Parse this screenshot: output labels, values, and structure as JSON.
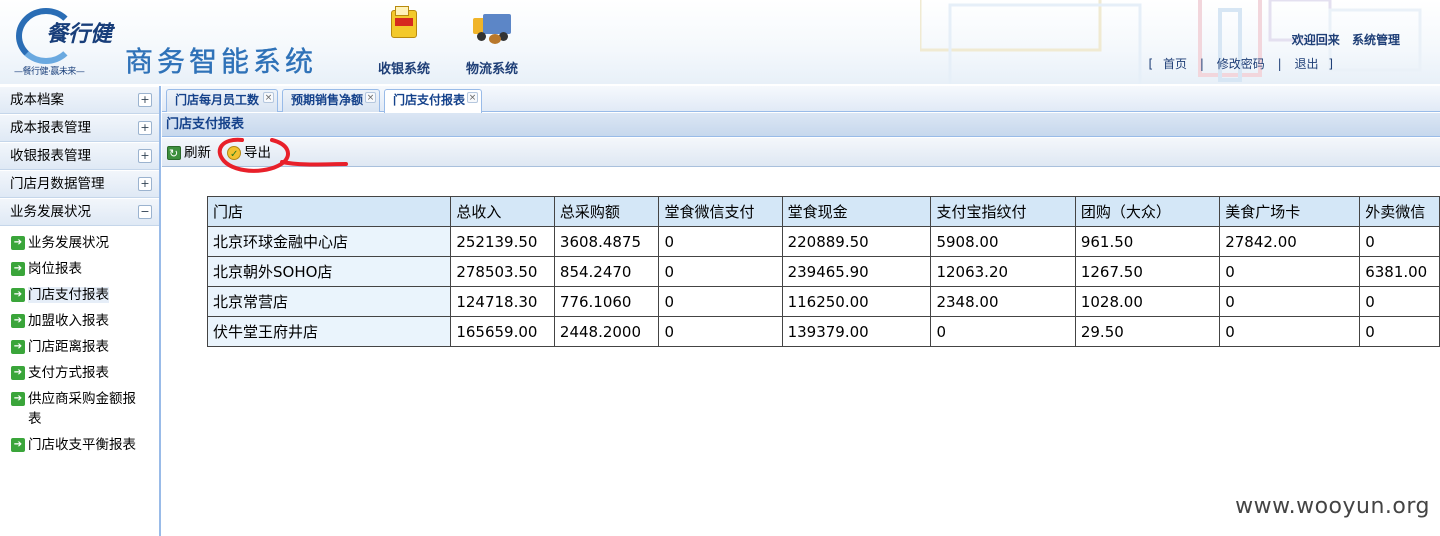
{
  "header": {
    "logo_cn": "餐行健",
    "logo_slogan": "—餐行健·赢未来—",
    "app_title": "商务智能系统",
    "systems": [
      {
        "label": "收银系统",
        "icon": "cash-register-icon"
      },
      {
        "label": "物流系统",
        "icon": "delivery-truck-icon"
      }
    ],
    "welcome": "欢迎回来",
    "user": "系统管理",
    "links": {
      "home": "首页",
      "change_password": "修改密码",
      "logout": "退出",
      "open": "[",
      "close": "]",
      "sep": "|"
    }
  },
  "sidebar": {
    "groups": [
      {
        "label": "成本档案",
        "toggle": "+"
      },
      {
        "label": "成本报表管理",
        "toggle": "+"
      },
      {
        "label": "收银报表管理",
        "toggle": "+"
      },
      {
        "label": "门店月数据管理",
        "toggle": "+"
      },
      {
        "label": "业务发展状况",
        "toggle": "−"
      }
    ],
    "items": [
      {
        "label": "业务发展状况"
      },
      {
        "label": "岗位报表"
      },
      {
        "label": "门店支付报表"
      },
      {
        "label": "加盟收入报表"
      },
      {
        "label": "门店距离报表"
      },
      {
        "label": "支付方式报表"
      },
      {
        "label": "供应商采购金额报表"
      },
      {
        "label": "门店收支平衡报表"
      }
    ]
  },
  "tabs": [
    {
      "label": "门店每月员工数",
      "close": "×"
    },
    {
      "label": "预期销售净额",
      "close": "×"
    },
    {
      "label": "门店支付报表",
      "close": "×",
      "active": true
    }
  ],
  "panel": {
    "title": "门店支付报表"
  },
  "toolbar": {
    "refresh": "刷新",
    "export": "导出"
  },
  "table": {
    "columns": [
      "门店",
      "总收入",
      "总采购额",
      "堂食微信支付",
      "堂食现金",
      "支付宝指纹付",
      "团购（大众）",
      "美食广场卡",
      "外卖微信"
    ],
    "rows": [
      [
        "北京环球金融中心店",
        "252139.50",
        "3608.4875",
        "0",
        "220889.50",
        "5908.00",
        "961.50",
        "27842.00",
        "0"
      ],
      [
        "北京朝外SOHO店",
        "278503.50",
        "854.2470",
        "0",
        "239465.90",
        "12063.20",
        "1267.50",
        "0",
        "6381.00"
      ],
      [
        "北京常营店",
        "124718.30",
        "776.1060",
        "0",
        "116250.00",
        "2348.00",
        "1028.00",
        "0",
        "0"
      ],
      [
        "伏牛堂王府井店",
        "165659.00",
        "2448.2000",
        "0",
        "139379.00",
        "0",
        "29.50",
        "0",
        "0"
      ]
    ]
  },
  "watermark": "www.wooyun.org",
  "colors": {
    "accent": "#15428b",
    "border": "#99bbe8",
    "annotation": "#e8202a"
  }
}
